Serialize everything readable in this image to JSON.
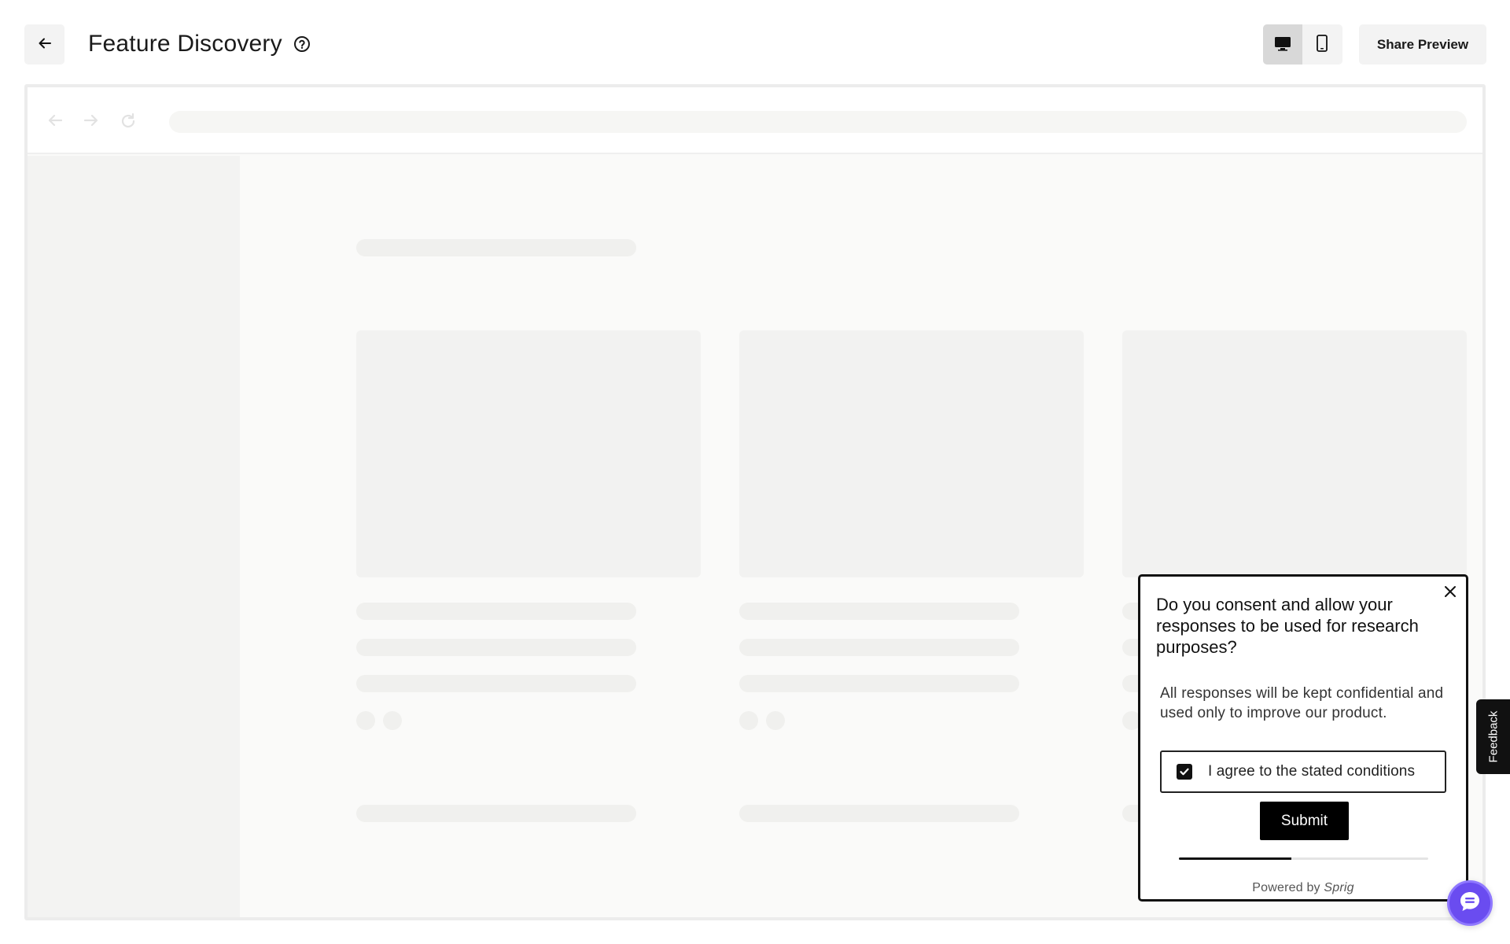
{
  "header": {
    "title": "Feature Discovery",
    "back_icon": "arrow-left-icon",
    "help_icon": "question-circle-icon",
    "device_toggle": {
      "desktop_icon": "desktop-icon",
      "mobile_icon": "mobile-icon",
      "active": "desktop"
    },
    "share_label": "Share Preview"
  },
  "preview": {
    "browser_icons": [
      "back-arrow-icon",
      "forward-arrow-icon",
      "reload-icon"
    ]
  },
  "survey": {
    "question": "Do you consent and allow your responses to be used for research purposes?",
    "description": "All responses will be kept confidential and used only to improve our product.",
    "consent_label": "I agree to the stated conditions",
    "consent_checked": true,
    "submit_label": "Submit",
    "progress_fraction": 0.45,
    "powered_prefix": "Powered by ",
    "brand": "Sprig",
    "close_icon": "close-icon"
  },
  "feedback_tab": {
    "label": "Feedback"
  },
  "chat": {
    "icon": "chat-bubble-icon",
    "accent": "#6a4cf0"
  }
}
